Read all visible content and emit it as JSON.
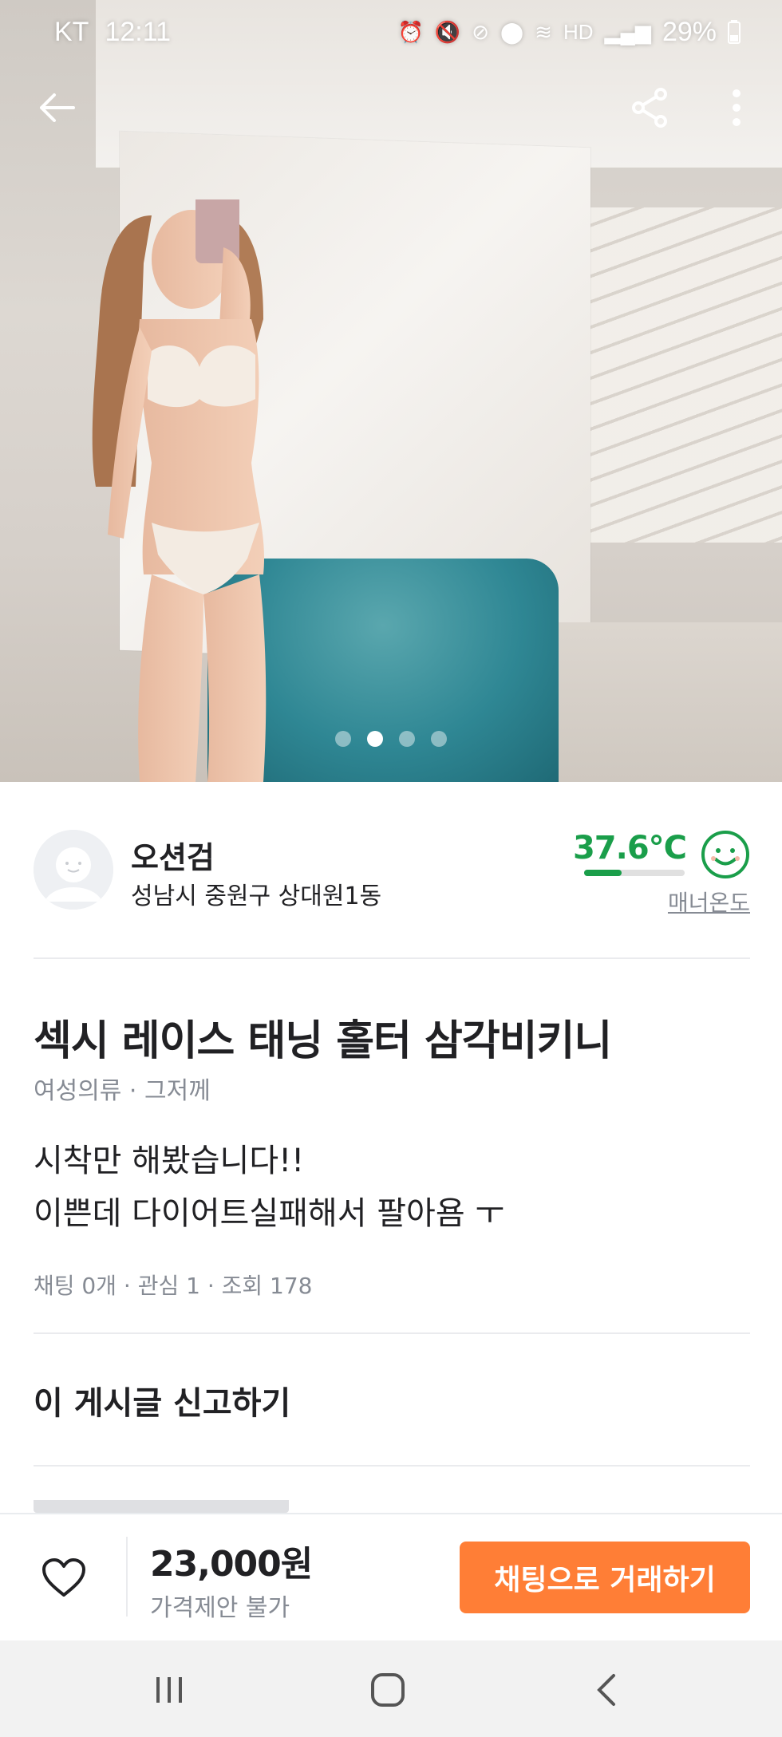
{
  "status_bar": {
    "carrier": "KT",
    "time": "12:11",
    "battery": "29%",
    "icons": [
      "alarm-icon",
      "vibrate-mute-icon",
      "battery-saver-icon",
      "location-icon",
      "wifi-icon",
      "hd-voice-icon",
      "signal-icon",
      "battery-icon"
    ]
  },
  "gallery": {
    "image_count": 4,
    "active_index": 1
  },
  "seller": {
    "name": "오션검",
    "region": "성남시 중원구 상대원1동",
    "manner_temp": "37.6°C",
    "manner_fill": 0.376,
    "manner_label": "매너온도"
  },
  "post": {
    "title": "섹시 레이스 태닝 홀터 삼각비키니",
    "meta": "여성의류 · 그저께",
    "desc_line1": "시착만 해봤습니다!!",
    "desc_line2": "이쁜데 다이어트실패해서 팔아욤 ㅜ",
    "stats": "채팅 0개 · 관심 1 · 조회 178",
    "report": "이 게시글 신고하기"
  },
  "action_bar": {
    "price": "23,000원",
    "price_note": "가격제안 불가",
    "chat_button": "채팅으로 거래하기"
  },
  "colors": {
    "accent": "#ff7e36",
    "manner_green": "#1a9e4a",
    "text_primary": "#212124",
    "text_secondary": "#868b94"
  }
}
